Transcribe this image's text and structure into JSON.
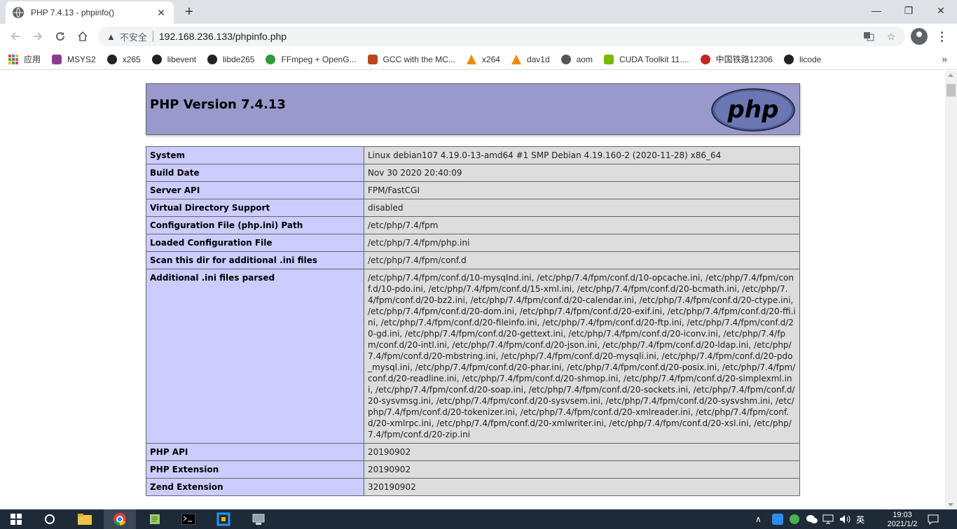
{
  "browser": {
    "tab_title": "PHP 7.4.13 - phpinfo()",
    "tab_close": "✕",
    "new_tab": "+",
    "window_min": "—",
    "window_restore": "❐",
    "window_close": "✕",
    "insecure_label": "不安全",
    "url": "192.168.236.133/phpinfo.php"
  },
  "bookmarks": [
    {
      "label": "应用",
      "icon": "apps-grid-icon"
    },
    {
      "label": "MSYS2",
      "icon": "msys2-icon",
      "color": "#8a3b8f"
    },
    {
      "label": "x265",
      "icon": "github-icon",
      "color": "#222"
    },
    {
      "label": "libevent",
      "icon": "github-icon",
      "color": "#222"
    },
    {
      "label": "libde265",
      "icon": "github-icon",
      "color": "#222"
    },
    {
      "label": "FFmpeg + OpenG...",
      "icon": "ffmpeg-icon",
      "color": "#2e9c3d"
    },
    {
      "label": "GCC with the MC...",
      "icon": "gcc-icon",
      "color": "#b9471c"
    },
    {
      "label": "x264",
      "icon": "vlc-icon",
      "color": "#f28a00"
    },
    {
      "label": "dav1d",
      "icon": "vlc-icon",
      "color": "#f28a00"
    },
    {
      "label": "aom",
      "icon": "globe-icon",
      "color": "#555"
    },
    {
      "label": "CUDA Toolkit 11....",
      "icon": "nvidia-icon",
      "color": "#76b900"
    },
    {
      "label": "中国铁路12306",
      "icon": "railway-icon",
      "color": "#c2272d"
    },
    {
      "label": "licode",
      "icon": "github-icon",
      "color": "#222"
    }
  ],
  "bookmarks_more": "»",
  "php": {
    "version_title": "PHP Version 7.4.13",
    "logo_text": "php"
  },
  "info_rows": [
    {
      "key": "System",
      "value": "Linux debian107 4.19.0-13-amd64 #1 SMP Debian 4.19.160-2 (2020-11-28) x86_64"
    },
    {
      "key": "Build Date",
      "value": "Nov 30 2020 20:40:09"
    },
    {
      "key": "Server API",
      "value": "FPM/FastCGI"
    },
    {
      "key": "Virtual Directory Support",
      "value": "disabled"
    },
    {
      "key": "Configuration File (php.ini) Path",
      "value": "/etc/php/7.4/fpm"
    },
    {
      "key": "Loaded Configuration File",
      "value": "/etc/php/7.4/fpm/php.ini"
    },
    {
      "key": "Scan this dir for additional .ini files",
      "value": "/etc/php/7.4/fpm/conf.d"
    },
    {
      "key": "Additional .ini files parsed",
      "value": "/etc/php/7.4/fpm/conf.d/10-mysqlnd.ini, /etc/php/7.4/fpm/conf.d/10-opcache.ini, /etc/php/7.4/fpm/conf.d/10-pdo.ini, /etc/php/7.4/fpm/conf.d/15-xml.ini, /etc/php/7.4/fpm/conf.d/20-bcmath.ini, /etc/php/7.4/fpm/conf.d/20-bz2.ini, /etc/php/7.4/fpm/conf.d/20-calendar.ini, /etc/php/7.4/fpm/conf.d/20-ctype.ini, /etc/php/7.4/fpm/conf.d/20-dom.ini, /etc/php/7.4/fpm/conf.d/20-exif.ini, /etc/php/7.4/fpm/conf.d/20-ffi.ini, /etc/php/7.4/fpm/conf.d/20-fileinfo.ini, /etc/php/7.4/fpm/conf.d/20-ftp.ini, /etc/php/7.4/fpm/conf.d/20-gd.ini, /etc/php/7.4/fpm/conf.d/20-gettext.ini, /etc/php/7.4/fpm/conf.d/20-iconv.ini, /etc/php/7.4/fpm/conf.d/20-intl.ini, /etc/php/7.4/fpm/conf.d/20-json.ini, /etc/php/7.4/fpm/conf.d/20-ldap.ini, /etc/php/7.4/fpm/conf.d/20-mbstring.ini, /etc/php/7.4/fpm/conf.d/20-mysqli.ini, /etc/php/7.4/fpm/conf.d/20-pdo_mysql.ini, /etc/php/7.4/fpm/conf.d/20-phar.ini, /etc/php/7.4/fpm/conf.d/20-posix.ini, /etc/php/7.4/fpm/conf.d/20-readline.ini, /etc/php/7.4/fpm/conf.d/20-shmop.ini, /etc/php/7.4/fpm/conf.d/20-simplexml.ini, /etc/php/7.4/fpm/conf.d/20-soap.ini, /etc/php/7.4/fpm/conf.d/20-sockets.ini, /etc/php/7.4/fpm/conf.d/20-sysvmsg.ini, /etc/php/7.4/fpm/conf.d/20-sysvsem.ini, /etc/php/7.4/fpm/conf.d/20-sysvshm.ini, /etc/php/7.4/fpm/conf.d/20-tokenizer.ini, /etc/php/7.4/fpm/conf.d/20-xmlreader.ini, /etc/php/7.4/fpm/conf.d/20-xmlrpc.ini, /etc/php/7.4/fpm/conf.d/20-xmlwriter.ini, /etc/php/7.4/fpm/conf.d/20-xsl.ini, /etc/php/7.4/fpm/conf.d/20-zip.ini"
    },
    {
      "key": "PHP API",
      "value": "20190902"
    },
    {
      "key": "PHP Extension",
      "value": "20190902"
    },
    {
      "key": "Zend Extension",
      "value": "320190902"
    }
  ],
  "taskbar": {
    "ime_label": "英",
    "time": "19:03",
    "date": "2021/1/2"
  },
  "colors": {
    "php_header": "#9999cc",
    "key_cell": "#ccccff",
    "value_cell": "#dddddd"
  }
}
